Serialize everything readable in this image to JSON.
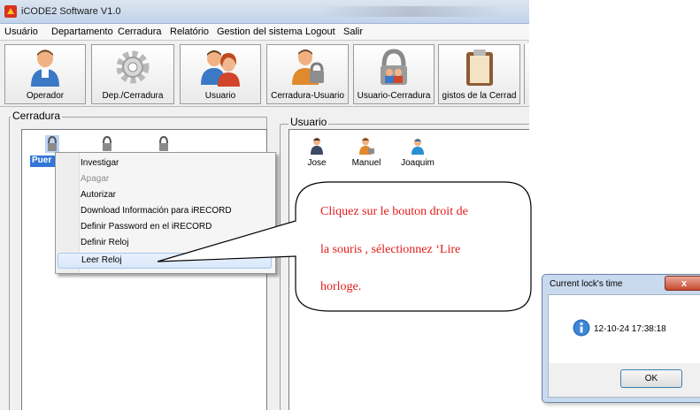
{
  "window": {
    "title": "iCODE2 Software V1.0"
  },
  "menu": [
    "Usuário",
    "Departamento",
    "Cerradura",
    "Relatório",
    "Gestion del sistema",
    "Logout",
    "Salir"
  ],
  "toolbar": [
    {
      "label": "Operador",
      "icon": "operator-icon"
    },
    {
      "label": "Dep./Cerradura",
      "icon": "gear-icon"
    },
    {
      "label": "Usuario",
      "icon": "users-icon"
    },
    {
      "label": "Cerradura-Usuario",
      "icon": "user-lock-icon"
    },
    {
      "label": "Usuario-Cerradura",
      "icon": "lock-users-icon"
    },
    {
      "label": "gistos de la Cerrad",
      "icon": "clipboard-icon"
    }
  ],
  "panels": {
    "cerradura": {
      "title": "Cerradura",
      "selected_label": "Puer"
    },
    "usuario": {
      "title": "Usuario",
      "users": [
        "Jose",
        "Manuel",
        "Joaquim"
      ]
    }
  },
  "context_menu": [
    {
      "label": "Investigar",
      "disabled": false
    },
    {
      "label": "Apagar",
      "disabled": true
    },
    {
      "label": "Autorizar",
      "disabled": false
    },
    {
      "label": "Download Información para iRECORD",
      "disabled": false
    },
    {
      "label": "Definir Password en el iRECORD",
      "disabled": false
    },
    {
      "label": "Definir Reloj",
      "disabled": false
    },
    {
      "label": "Leer Reloj",
      "disabled": false,
      "highlighted": true
    }
  ],
  "callout": {
    "lines": [
      "Cliquez sur le bouton droit de",
      "la souris   , sélectionnez ‘Lire",
      "horloge."
    ],
    "color": "#e31a1a"
  },
  "dialog": {
    "title": "Current lock's time",
    "close_label": "x",
    "message": "12-10-24  17:38:18",
    "ok_label": "OK"
  }
}
